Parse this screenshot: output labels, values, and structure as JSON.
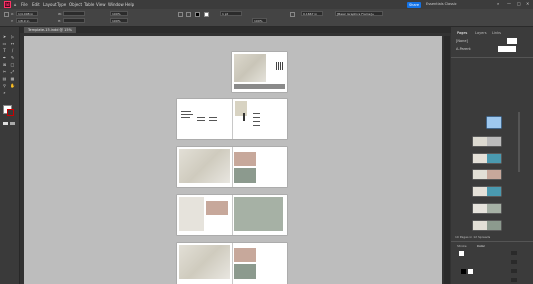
{
  "menu": {
    "items": [
      "File",
      "Edit",
      "Layout",
      "Type",
      "Object",
      "Table",
      "View",
      "Window",
      "Help"
    ]
  },
  "share_label": "Share",
  "workspace": "Essentials Classic",
  "control": {
    "x_label": "X:",
    "x_value": "1/4.008 in",
    "y_label": "Y:",
    "y_value": "1/8.9 in",
    "w_label": "W:",
    "h_label": "H:",
    "stroke_weight": "1 pt",
    "opacity": "100%",
    "scale": "0.1667 in",
    "style": "[Basic Graphics Frame]+",
    "scale_pct_1": "100%",
    "scale_pct_2": "100%"
  },
  "document_tab": "Template-15.indd @ 15%",
  "panel": {
    "tabs": [
      "Pages",
      "Layers",
      "Links"
    ],
    "none_label": "[None]",
    "parent_label": "A-Parent",
    "status": "10 Pages in 12 Spreads",
    "stroke_tab": "Stroke",
    "color_tab": "Color"
  },
  "window": {
    "min": "—",
    "max": "□",
    "close": "✕"
  },
  "colors": {
    "share": "#1473e6",
    "pasteboard": "#bdbdbd",
    "selection": "#9ec8ee"
  }
}
